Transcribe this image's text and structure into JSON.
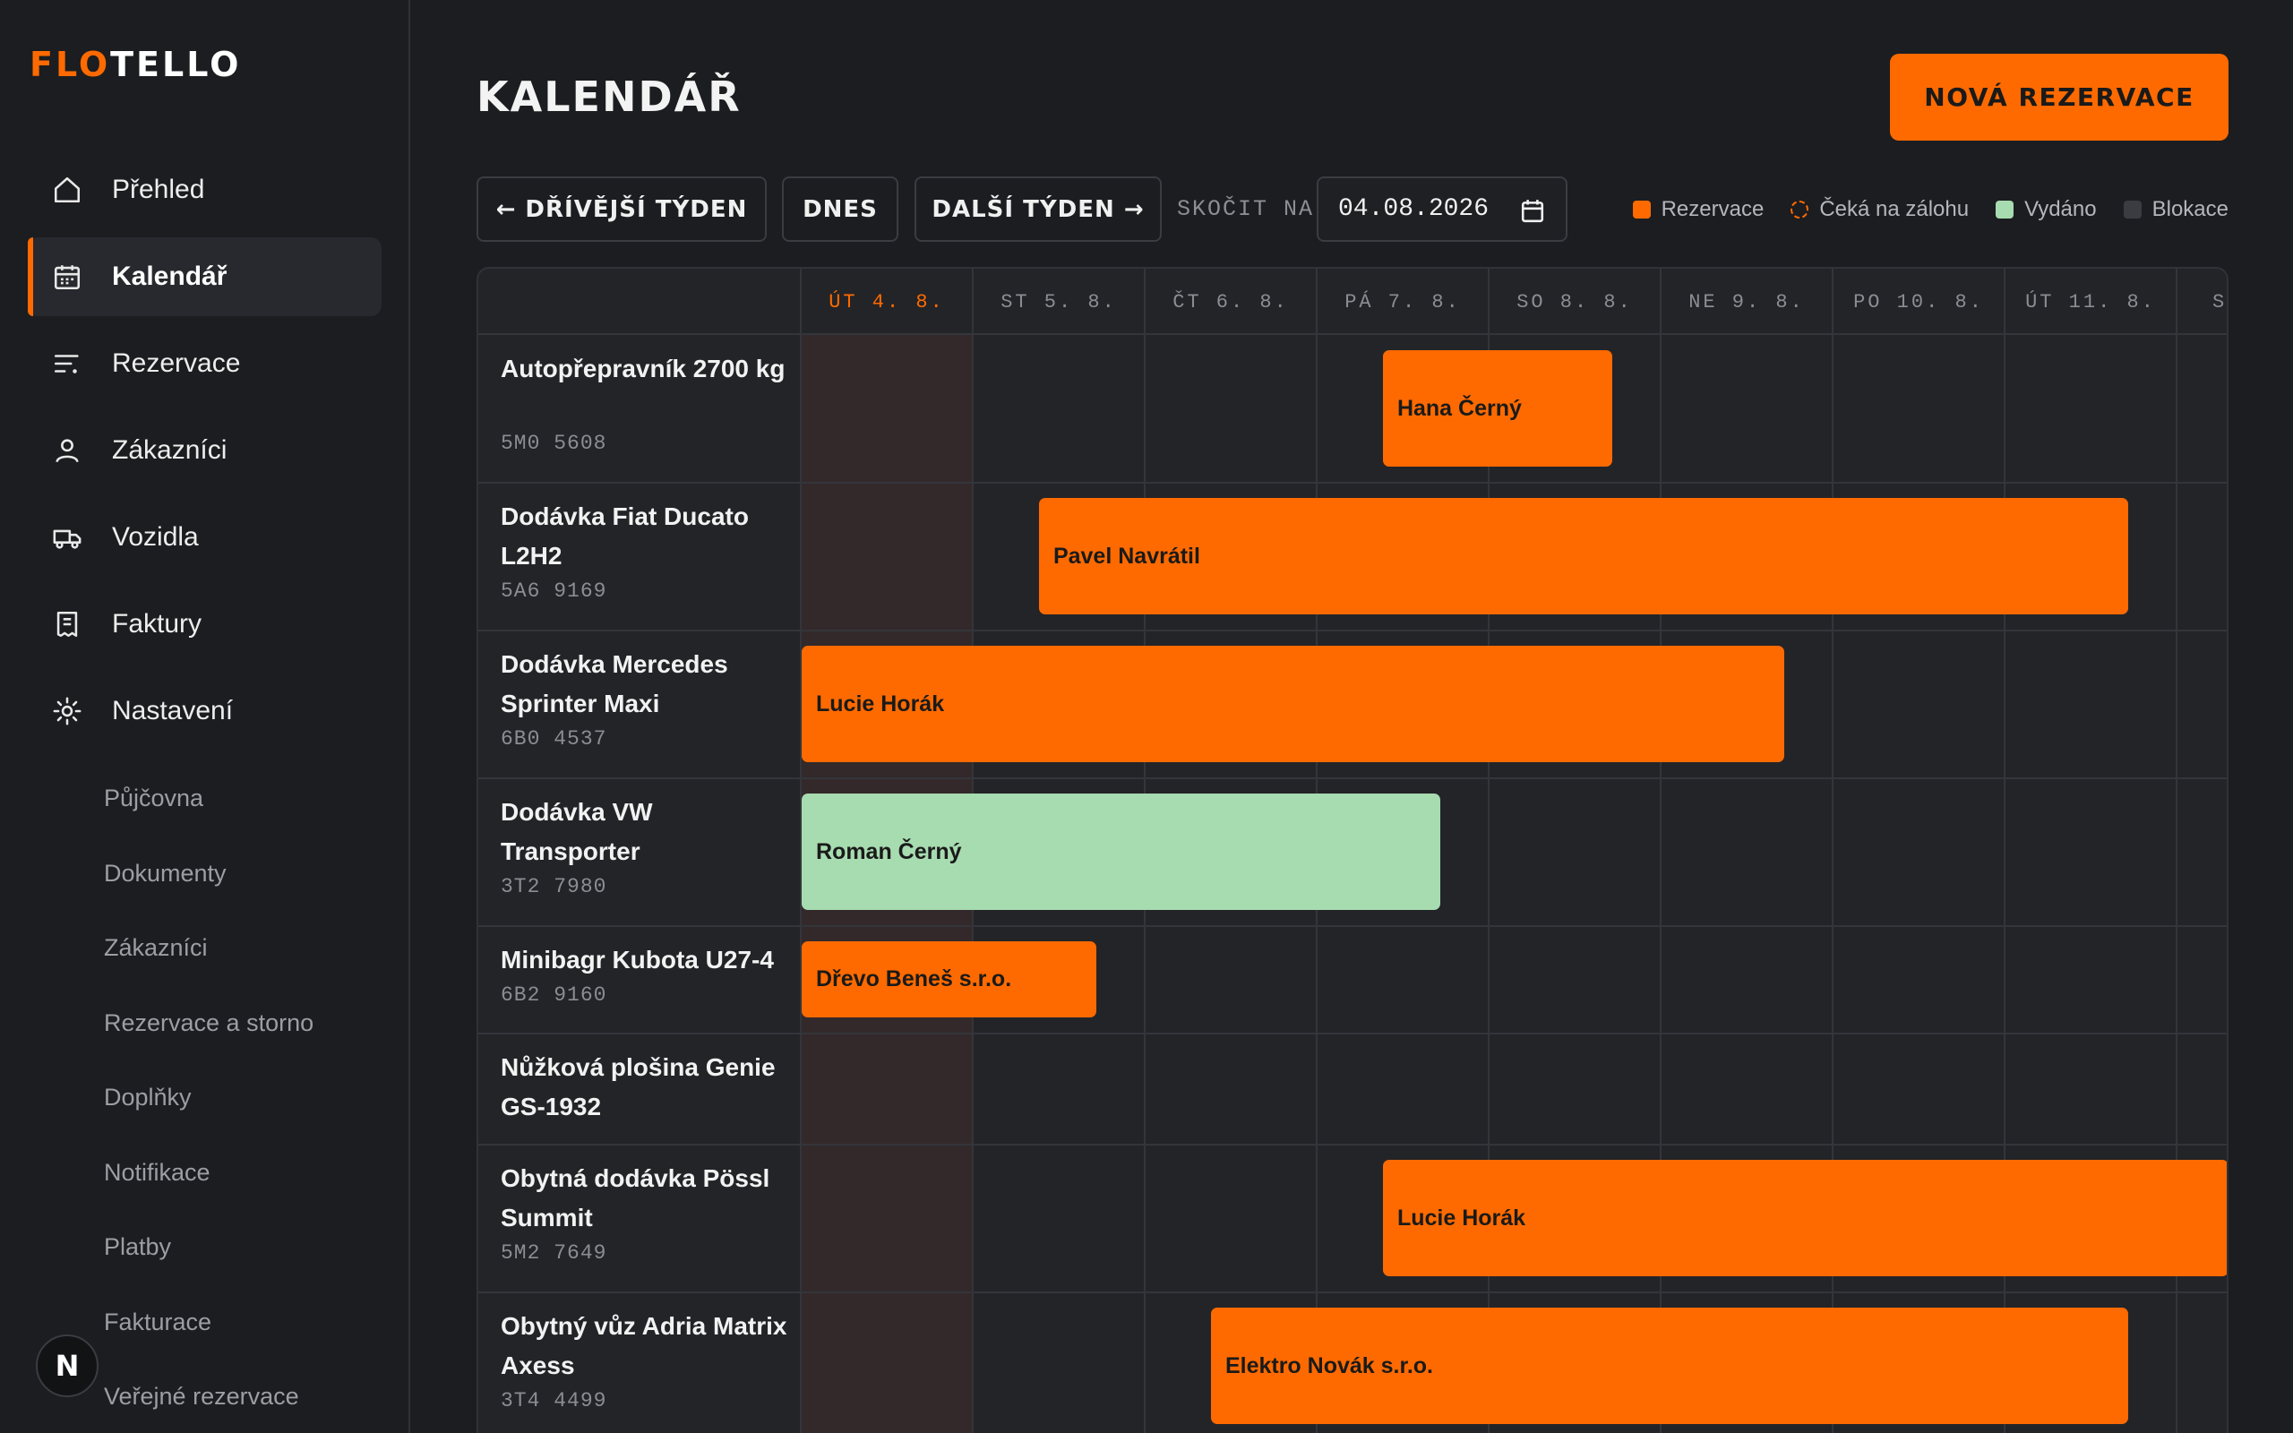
{
  "app": {
    "logo_part1": "FLO",
    "logo_part2": "TELLO",
    "badge": "N"
  },
  "sidebar": {
    "items": [
      {
        "label": "Přehled",
        "icon": "home-icon"
      },
      {
        "label": "Kalendář",
        "icon": "calendar-icon",
        "active": true
      },
      {
        "label": "Rezervace",
        "icon": "list-icon"
      },
      {
        "label": "Zákazníci",
        "icon": "user-icon"
      },
      {
        "label": "Vozidla",
        "icon": "truck-icon"
      },
      {
        "label": "Faktury",
        "icon": "invoice-icon"
      },
      {
        "label": "Nastavení",
        "icon": "gear-icon"
      }
    ],
    "sub_items": [
      "Půjčovna",
      "Dokumenty",
      "Zákazníci",
      "Rezervace a storno",
      "Doplňky",
      "Notifikace",
      "Platby",
      "Fakturace",
      "Veřejné rezervace"
    ]
  },
  "header": {
    "title": "KALENDÁŘ",
    "new_button": "NOVÁ REZERVACE"
  },
  "toolbar": {
    "prev": "← DŘÍVĚJŠÍ TÝDEN",
    "today": "DNES",
    "next": "DALŠÍ TÝDEN →",
    "jump_label": "SKOČIT NA",
    "date_value": "04.08.2026"
  },
  "legend": [
    {
      "label": "Rezervace",
      "color": "#ff6a00",
      "style": "solid"
    },
    {
      "label": "Čeká na zálohu",
      "color": "#ff6a00",
      "style": "dashed"
    },
    {
      "label": "Vydáno",
      "color": "#a7dbb0",
      "style": "solid"
    },
    {
      "label": "Blokace",
      "color": "#3a3c42",
      "style": "solid"
    }
  ],
  "calendar": {
    "days": [
      "ÚT 4. 8.",
      "ST 5. 8.",
      "ČT 6. 8.",
      "PÁ 7. 8.",
      "SO 8. 8.",
      "NE 9. 8.",
      "PO 10. 8.",
      "ÚT 11. 8.",
      "ST"
    ],
    "today_index": 0,
    "vehicles": [
      {
        "name": "Autopřepravník 2700 kg",
        "plate": "5M0 5608"
      },
      {
        "name": "Dodávka Fiat Ducato L2H2",
        "plate": "5A6 9169"
      },
      {
        "name": "Dodávka Mercedes Sprinter Maxi",
        "plate": "6B0 4537"
      },
      {
        "name": "Dodávka VW Transporter",
        "plate": "3T2 7980"
      },
      {
        "name": "Minibagr Kubota U27-4",
        "plate": "6B2 9160"
      },
      {
        "name": "Nůžková plošina Genie GS-1932",
        "plate": ""
      },
      {
        "name": "Obytná dodávka Pössl Summit",
        "plate": "5M2 7649"
      },
      {
        "name": "Obytný vůz Adria Matrix Axess",
        "plate": "3T4 4499"
      }
    ],
    "bookings": [
      {
        "vehicle": 0,
        "customer": "Hana Černý",
        "status": "Rezervace",
        "start_day": 3.38,
        "end_day": 4.72
      },
      {
        "vehicle": 1,
        "customer": "Pavel Navrátil",
        "status": "Rezervace",
        "start_day": 1.38,
        "end_day": 7.72
      },
      {
        "vehicle": 2,
        "customer": "Lucie Horák",
        "status": "Rezervace",
        "start_day": 0.0,
        "end_day": 5.72
      },
      {
        "vehicle": 3,
        "customer": "Roman Černý",
        "status": "Vydáno",
        "start_day": 0.0,
        "end_day": 3.72
      },
      {
        "vehicle": 4,
        "customer": "Dřevo Beneš s.r.o.",
        "status": "Rezervace",
        "start_day": 0.0,
        "end_day": 1.72
      },
      {
        "vehicle": 6,
        "customer": "Lucie Horák",
        "status": "Rezervace",
        "start_day": 3.38,
        "end_day": 8.4
      },
      {
        "vehicle": 7,
        "customer": "Elektro Novák s.r.o.",
        "status": "Rezervace",
        "start_day": 2.38,
        "end_day": 7.72
      }
    ]
  }
}
